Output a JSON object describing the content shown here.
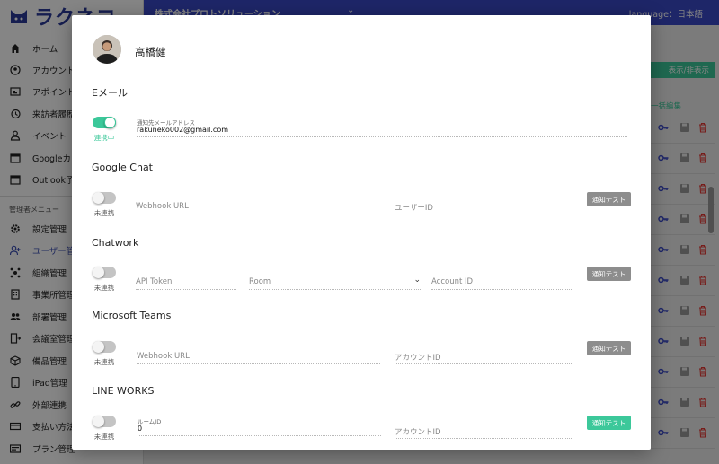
{
  "app": {
    "logo_text": "ラクネコ"
  },
  "header": {
    "company": "株式会社プロトソリューション",
    "language": "language：日本語"
  },
  "sidebar": {
    "items": [
      {
        "label": "ホーム",
        "icon": "home-icon"
      },
      {
        "label": "アカウント",
        "icon": "account-circle-icon"
      },
      {
        "label": "アポイント",
        "icon": "appointment-icon"
      },
      {
        "label": "来訪者履歴",
        "icon": "history-icon"
      },
      {
        "label": "イベント",
        "icon": "person-icon"
      },
      {
        "label": "Googleカレ",
        "icon": "calendar-icon"
      },
      {
        "label": "Outlook予定",
        "icon": "calendar-icon"
      }
    ],
    "admin_section": "管理者メニュー",
    "admin_items": [
      {
        "label": "設定管理",
        "icon": "gear-icon"
      },
      {
        "label": "ユーザー管理",
        "icon": "user-add-icon"
      },
      {
        "label": "組織管理",
        "icon": "org-icon"
      },
      {
        "label": "事業所管理",
        "icon": "building-icon"
      },
      {
        "label": "部署管理",
        "icon": "group-icon"
      },
      {
        "label": "会議室管理",
        "icon": "room-icon"
      },
      {
        "label": "備品管理",
        "icon": "box-icon"
      },
      {
        "label": "iPad管理",
        "icon": "tablet-icon"
      },
      {
        "label": "外部連携",
        "icon": "link-icon"
      },
      {
        "label": "支払い方法",
        "icon": "payment-icon"
      },
      {
        "label": "プラン管理",
        "icon": "plan-icon"
      }
    ]
  },
  "background": {
    "toggle_display_button": "表示/非表示",
    "bulk_edit_link": "一括編集"
  },
  "modal": {
    "user_name": "高橋健",
    "email": {
      "title": "Eメール",
      "toggle_state": "連携中",
      "field_label": "通知先メールアドレス",
      "field_value": "rakuneko002@gmail.com"
    },
    "google_chat": {
      "title": "Google Chat",
      "toggle_state": "未連携",
      "webhook_placeholder": "Webhook URL",
      "user_id_placeholder": "ユーザーID",
      "test_button": "通知テスト"
    },
    "chatwork": {
      "title": "Chatwork",
      "toggle_state": "未連携",
      "api_token_placeholder": "API Token",
      "room_placeholder": "Room",
      "account_id_placeholder": "Account ID",
      "test_button": "通知テスト"
    },
    "teams": {
      "title": "Microsoft Teams",
      "toggle_state": "未連携",
      "webhook_placeholder": "Webhook URL",
      "account_id_placeholder": "アカウントID",
      "test_button": "通知テスト"
    },
    "line_works": {
      "title": "LINE WORKS",
      "toggle_state": "未連携",
      "room_id_label": "ルームID",
      "room_id_value": "0",
      "account_id_placeholder": "アカウントID",
      "test_button": "通知テスト"
    }
  },
  "colors": {
    "primary": "#3b49c8",
    "accent": "#3cc89a",
    "danger": "#e53935"
  }
}
